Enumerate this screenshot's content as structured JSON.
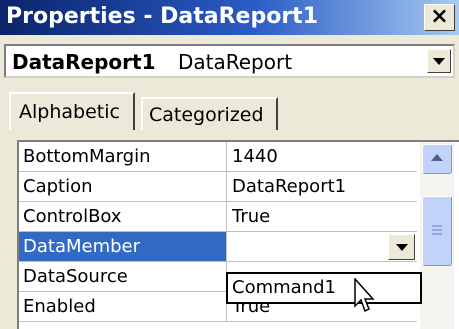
{
  "window": {
    "title": "Properties - DataReport1",
    "close_label": "×"
  },
  "object_selector": {
    "name": "DataReport1",
    "type": "DataReport"
  },
  "tabs": [
    {
      "label": "Alphabetic",
      "active": true
    },
    {
      "label": "Categorized",
      "active": false
    }
  ],
  "properties": [
    {
      "name": "BottomMargin",
      "value": "1440"
    },
    {
      "name": "Caption",
      "value": "DataReport1"
    },
    {
      "name": "ControlBox",
      "value": "True"
    },
    {
      "name": "DataMember",
      "value": ""
    },
    {
      "name": "DataSource",
      "value": ""
    },
    {
      "name": "Enabled",
      "value": "True"
    }
  ],
  "selected_property": "DataMember",
  "dropdown": {
    "options": [
      "Command1"
    ]
  },
  "colors": {
    "selection": "#316ac5",
    "titlebar": "#0a246a"
  },
  "icons": [
    "close-icon",
    "chevron-down-icon",
    "scroll-up-icon",
    "mouse-cursor-icon"
  ]
}
